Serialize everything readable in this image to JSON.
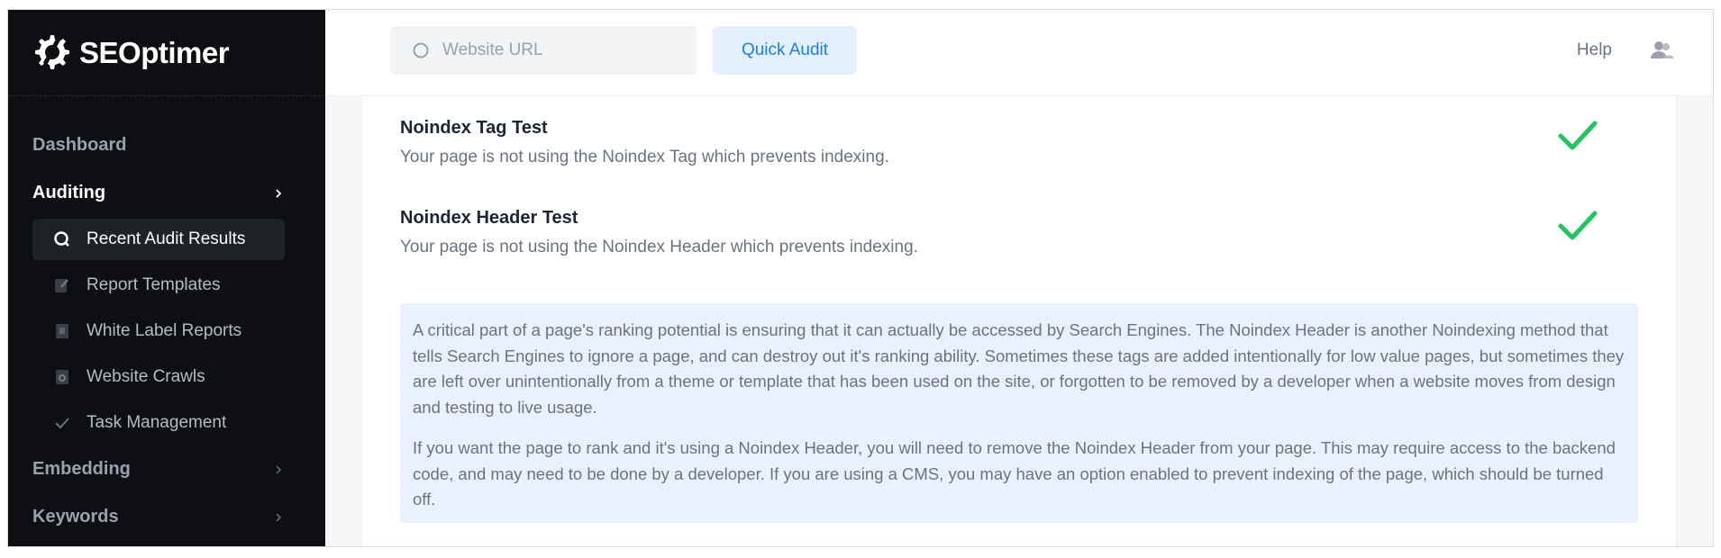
{
  "brand": {
    "name": "SEOptimer"
  },
  "header": {
    "search_placeholder": "Website URL",
    "quick_audit_label": "Quick Audit",
    "help_label": "Help"
  },
  "sidebar": {
    "sections": [
      {
        "label": "Dashboard"
      },
      {
        "label": "Auditing"
      },
      {
        "label": "Embedding"
      },
      {
        "label": "Keywords"
      }
    ],
    "auditing_items": [
      {
        "label": "Recent Audit Results",
        "icon": "search-icon"
      },
      {
        "label": "Report Templates",
        "icon": "edit-document-icon"
      },
      {
        "label": "White Label Reports",
        "icon": "document-icon"
      },
      {
        "label": "Website Crawls",
        "icon": "document-search-icon"
      },
      {
        "label": "Task Management",
        "icon": "check-icon"
      }
    ]
  },
  "tests": [
    {
      "title": "Noindex Tag Test",
      "description": "Your page is not using the Noindex Tag which prevents indexing.",
      "status": "pass"
    },
    {
      "title": "Noindex Header Test",
      "description": "Your page is not using the Noindex Header which prevents indexing.",
      "status": "pass"
    }
  ],
  "info_box": {
    "paragraph_1": "A critical part of a page's ranking potential is ensuring that it can actually be accessed by Search Engines. The Noindex Header is another Noindexing method that tells Search Engines to ignore a page, and can destroy out it's ranking ability. Sometimes these tags are added intentionally for low value pages, but sometimes they are left over unintentionally from a theme or template that has been used on the site, or forgotten to be removed by a developer when a website moves from design and testing to live usage.",
    "paragraph_2": "If you want the page to rank and it's using a Noindex Header, you will need to remove the Noindex Header from your page. This may require access to the backend code, and may need to be done by a developer. If you are using a CMS, you may have an option enabled to prevent indexing of the page, which should be turned off."
  },
  "colors": {
    "sidebar_bg": "#0d0f12",
    "accent_blue": "#1e7fe0",
    "pass_green": "#22c55e",
    "info_bg": "#e8f1fd"
  }
}
